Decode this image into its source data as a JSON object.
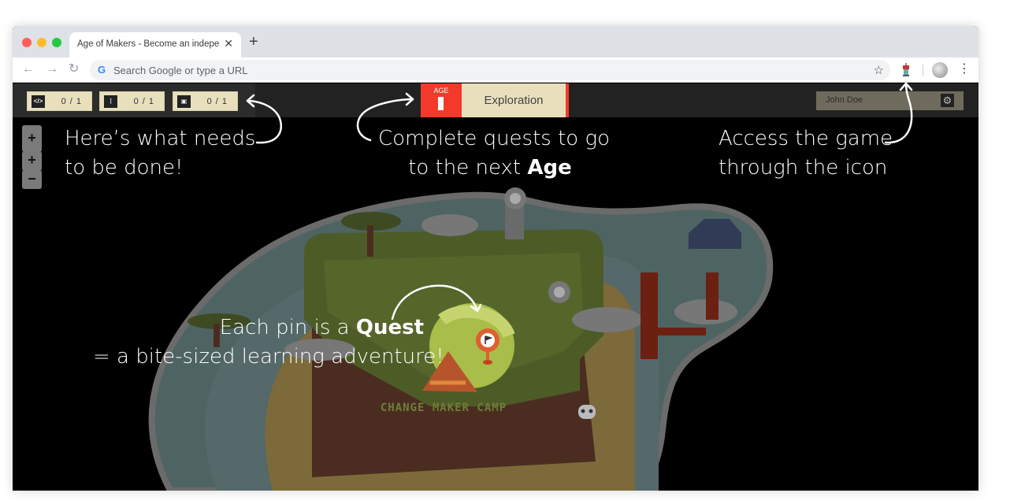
{
  "browser": {
    "tab_title": "Age of Makers - Become an indepe",
    "tab_close": "✕",
    "new_tab": "+",
    "back": "←",
    "forward": "→",
    "reload": "↻",
    "google_g": "G",
    "omnibox_placeholder": "Search Google or type a URL",
    "bookmark_star": "☆",
    "menu": "⋮"
  },
  "game": {
    "tasks": [
      {
        "icon": "</>",
        "name": "code",
        "count": "0 / 1"
      },
      {
        "icon": "⋮",
        "name": "flowchart",
        "count": "0 / 1"
      },
      {
        "icon": "▣",
        "name": "cube",
        "count": "0 / 1"
      }
    ],
    "age": {
      "label": "AGE",
      "stage_name": "Exploration"
    },
    "user": {
      "name": "John Doe",
      "settings_icon": "⚙"
    },
    "zoom": {
      "in": "+",
      "in2": "+",
      "out": "−"
    },
    "map_sign": "CHANGE MAKER CAMP"
  },
  "annotations": {
    "tasks_line1": "Here’s what needs",
    "tasks_line2": "to be done!",
    "age_line1": "Complete quests to go",
    "age_line2_prefix": "to the next ",
    "age_line2_bold": "Age",
    "icon_line1": "Access the game",
    "icon_line2": "through the icon",
    "quest_line1_prefix": "Each pin is a ",
    "quest_line1_bold": "Quest",
    "quest_line2": "= a bite-sized learning adventure!"
  }
}
